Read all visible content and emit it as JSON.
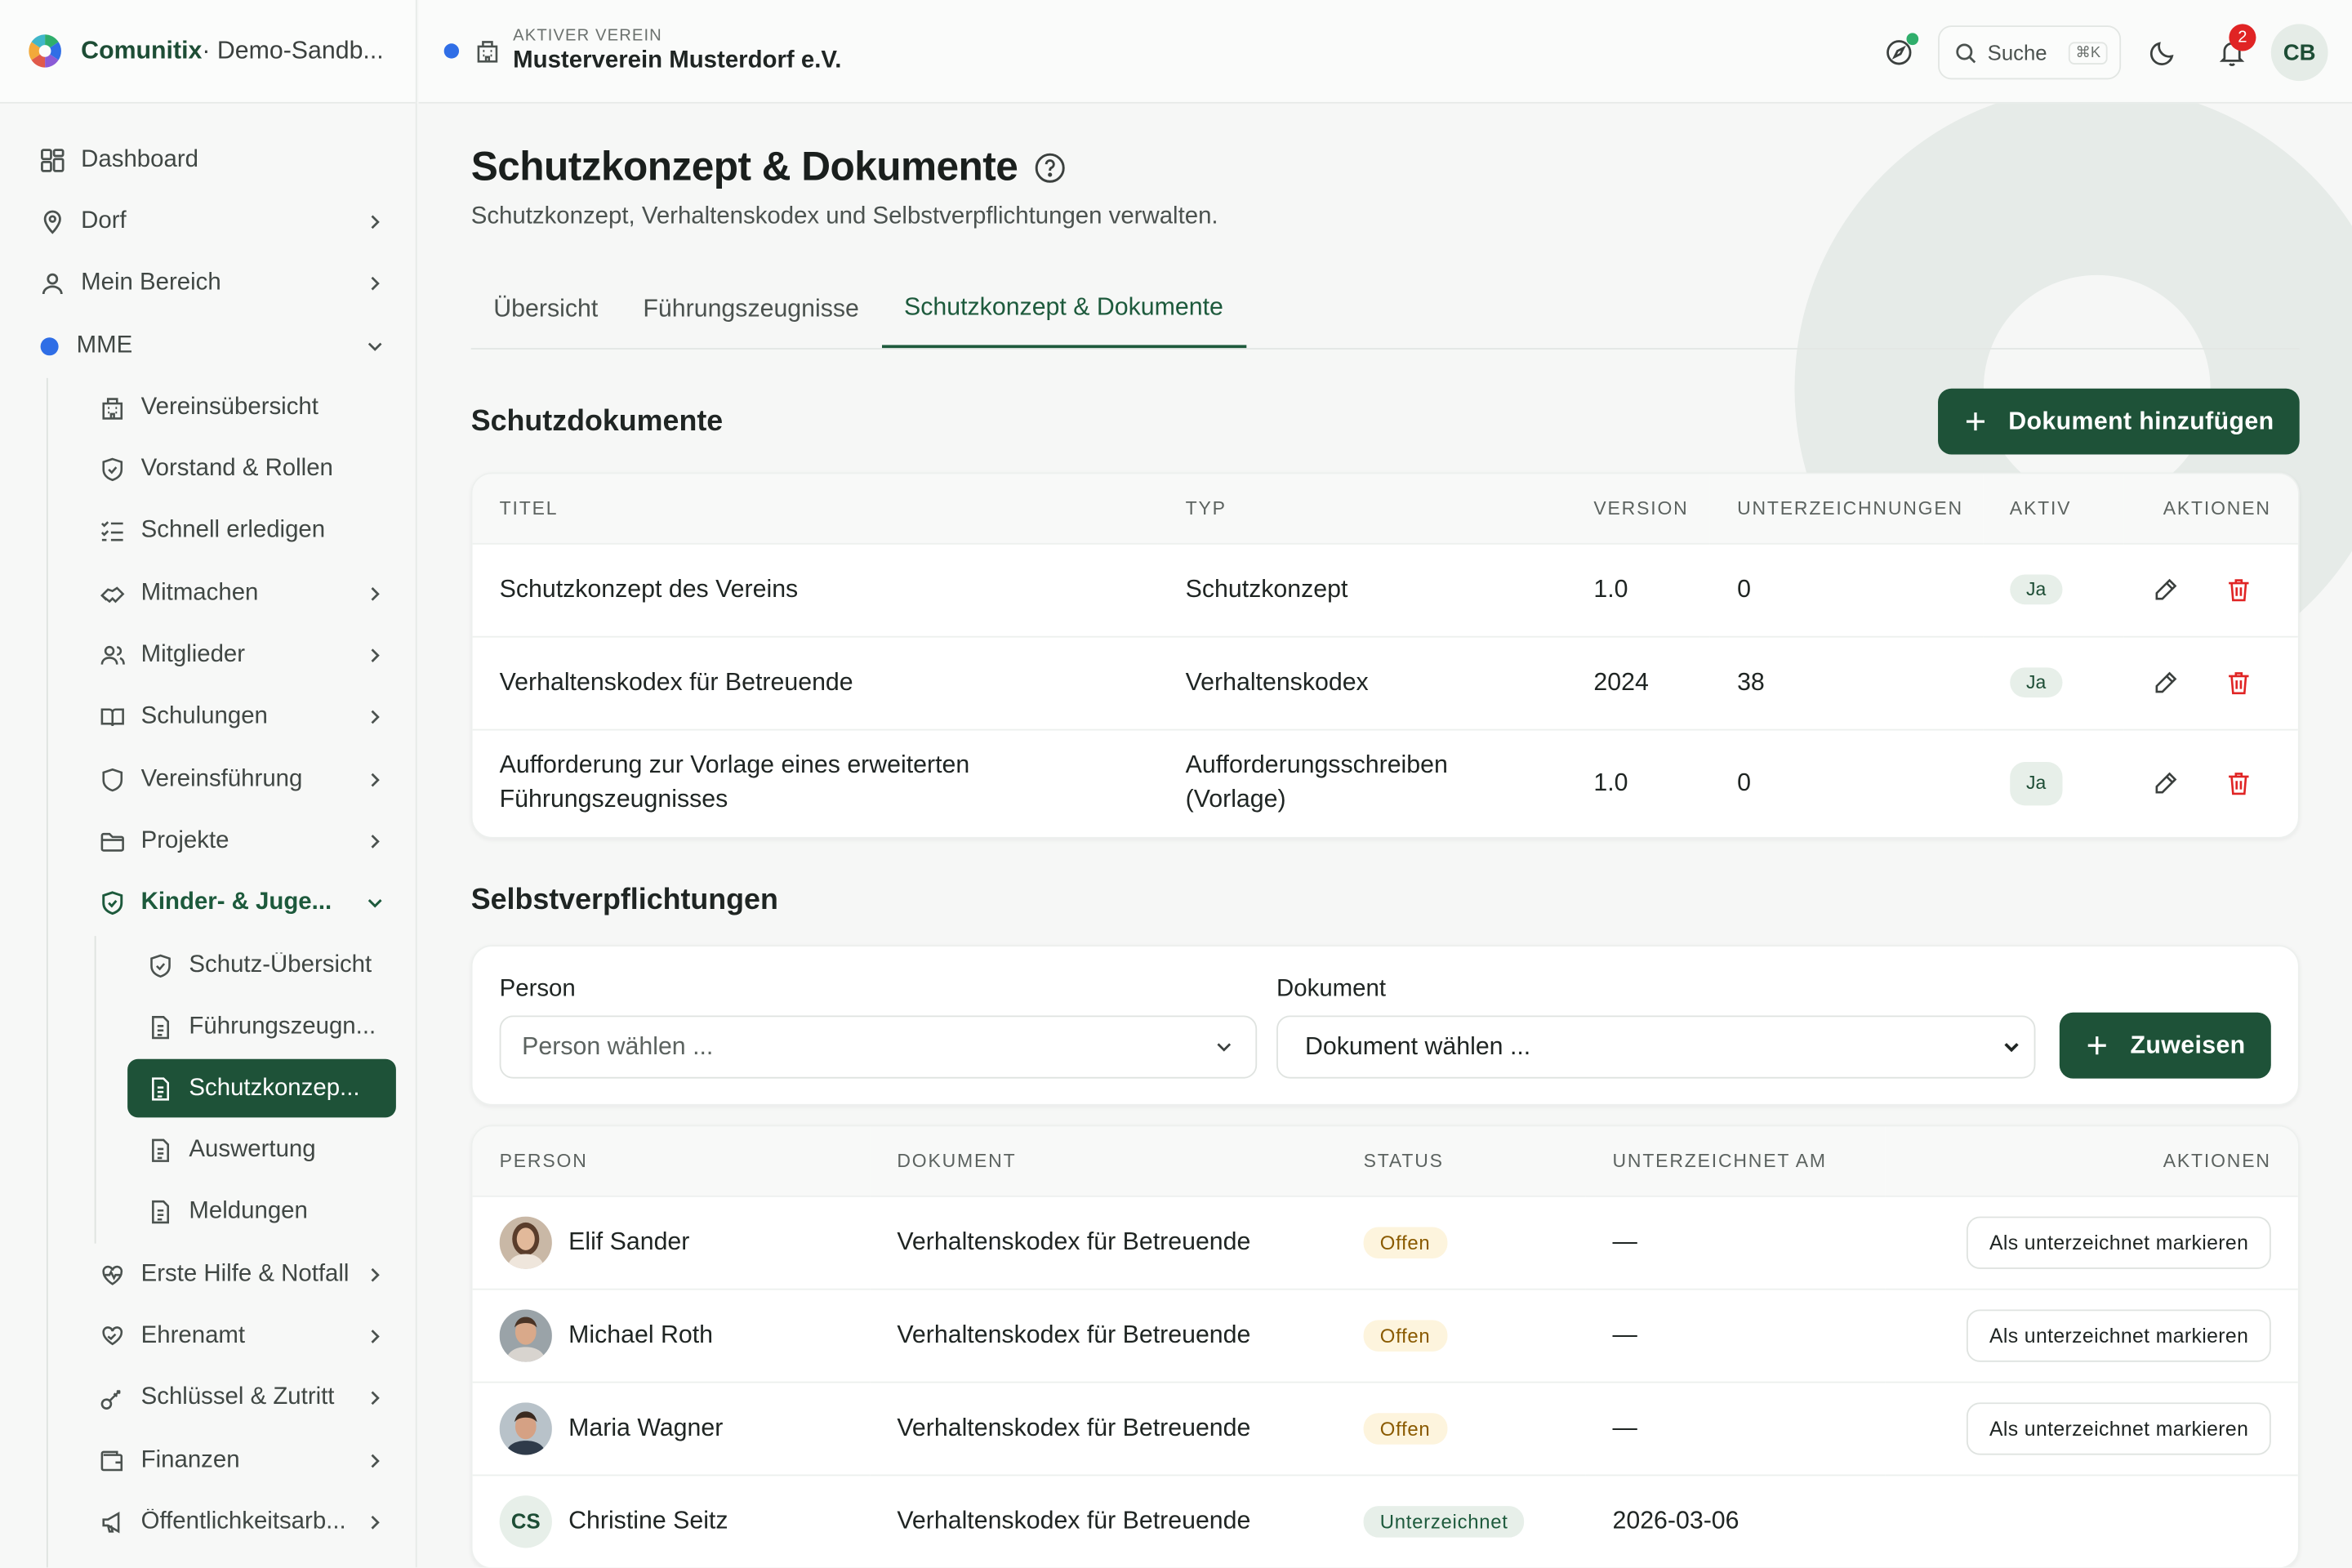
{
  "brand": {
    "name": "Comunitix",
    "env": " · Demo-Sandb..."
  },
  "header": {
    "club_kicker": "AKTIVER VEREIN",
    "club_name": "Musterverein Musterdorf e.V.",
    "search_label": "Suche",
    "search_kbd": "⌘K",
    "notifications": "2",
    "user_initials": "CB"
  },
  "sidebar": {
    "items": [
      {
        "label": "Dashboard",
        "icon": "dashboard-icon"
      },
      {
        "label": "Dorf",
        "icon": "map-pin-icon"
      },
      {
        "label": "Mein Bereich",
        "icon": "user-icon"
      },
      {
        "label": "MME",
        "icon": "blue-dot"
      },
      {
        "label": "Vereinsübersicht",
        "icon": "building-icon"
      },
      {
        "label": "Vorstand & Rollen",
        "icon": "shield-icon"
      },
      {
        "label": "Schnell erledigen",
        "icon": "checklist-icon"
      },
      {
        "label": "Mitmachen",
        "icon": "handshake-icon"
      },
      {
        "label": "Mitglieder",
        "icon": "users-icon"
      },
      {
        "label": "Schulungen",
        "icon": "book-icon"
      },
      {
        "label": "Vereinsführung",
        "icon": "shield-outline-icon"
      },
      {
        "label": "Projekte",
        "icon": "folder-icon"
      },
      {
        "label": "Kinder- & Juge...",
        "icon": "shield-check-icon"
      },
      {
        "label": "Schutz-Übersicht",
        "icon": "shield-check-icon"
      },
      {
        "label": "Führungszeugn...",
        "icon": "document-icon"
      },
      {
        "label": "Schutzkonzep...",
        "icon": "document-icon"
      },
      {
        "label": "Auswertung",
        "icon": "document-icon"
      },
      {
        "label": "Meldungen",
        "icon": "document-icon"
      },
      {
        "label": "Erste Hilfe & Notfall",
        "icon": "heart-icon"
      },
      {
        "label": "Ehrenamt",
        "icon": "heart-hand-icon"
      },
      {
        "label": "Schlüssel & Zutritt",
        "icon": "key-icon"
      },
      {
        "label": "Finanzen",
        "icon": "wallet-icon"
      },
      {
        "label": "Öffentlichkeitsarb...",
        "icon": "megaphone-icon"
      }
    ]
  },
  "page": {
    "title": "Schutzkonzept & Dokumente",
    "subtitle": "Schutzkonzept, Verhaltenskodex und Selbstverpflichtungen verwalten.",
    "tabs": [
      "Übersicht",
      "Führungszeugnisse",
      "Schutzkonzept & Dokumente"
    ]
  },
  "documents": {
    "heading": "Schutzdokumente",
    "add_button": "Dokument hinzufügen",
    "columns": [
      "TITEL",
      "TYP",
      "VERSION",
      "UNTERZEICHNUNGEN",
      "AKTIV",
      "AKTIONEN"
    ],
    "rows": [
      {
        "title": "Schutzkonzept des Vereins",
        "type": "Schutzkonzept",
        "version": "1.0",
        "signatures": "0",
        "active": "Ja"
      },
      {
        "title": "Verhaltenskodex für Betreuende",
        "type": "Verhaltenskodex",
        "version": "2024",
        "signatures": "38",
        "active": "Ja"
      },
      {
        "title": "Aufforderung zur Vorlage eines erweiterten Führungszeugnisses",
        "type": "Aufforderungsschreiben (Vorlage)",
        "version": "1.0",
        "signatures": "0",
        "active": "Ja"
      }
    ]
  },
  "commitments": {
    "heading": "Selbstverpflichtungen",
    "person_label": "Person",
    "person_placeholder": "Person wählen ...",
    "document_label": "Dokument",
    "document_placeholder": "Dokument wählen ...",
    "assign_button": "Zuweisen",
    "columns": [
      "PERSON",
      "DOKUMENT",
      "STATUS",
      "UNTERZEICHNET AM",
      "AKTIONEN"
    ],
    "rows": [
      {
        "name": "Elif Sander",
        "document": "Verhaltenskodex für Betreuende",
        "status": "Offen",
        "signed_at": "—",
        "action": "Als unterzeichnet markieren"
      },
      {
        "name": "Michael Roth",
        "document": "Verhaltenskodex für Betreuende",
        "status": "Offen",
        "signed_at": "—",
        "action": "Als unterzeichnet markieren"
      },
      {
        "name": "Maria Wagner",
        "document": "Verhaltenskodex für Betreuende",
        "status": "Offen",
        "signed_at": "—",
        "action": "Als unterzeichnet markieren"
      },
      {
        "name": "Christine Seitz",
        "initials": "CS",
        "document": "Verhaltenskodex für Betreuende",
        "status": "Unterzeichnet",
        "signed_at": "2026-03-06",
        "action": ""
      }
    ]
  },
  "colors": {
    "primary": "#1e5238",
    "accent_blue": "#2f6ee6",
    "danger": "#e02424"
  }
}
